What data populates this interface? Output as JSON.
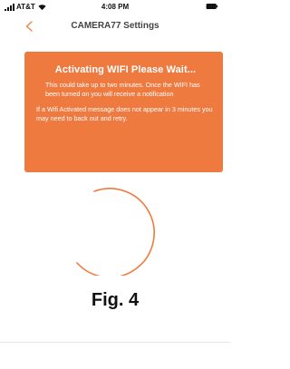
{
  "status_bar": {
    "carrier": "AT&T",
    "time": "4:08 PM",
    "icons": [
      "signal-icon",
      "wifi-icon",
      "battery-icon"
    ]
  },
  "nav": {
    "title": "CAMERA77 Settings",
    "back_icon": "chevron-left-icon"
  },
  "alert": {
    "title": "Activating WIFI Please Wait...",
    "body": "This could take up to two minutes. Once the WIFI has been turned on you will receive a notification",
    "note": "If a Wifi Activated message does not appear in 3 minutes you may need to back out and retry."
  },
  "figure_label": "Fig. 4",
  "colors": {
    "accent": "#ee7a40",
    "back_chevron": "#ee7a40",
    "spinner": "#ee7a40"
  }
}
